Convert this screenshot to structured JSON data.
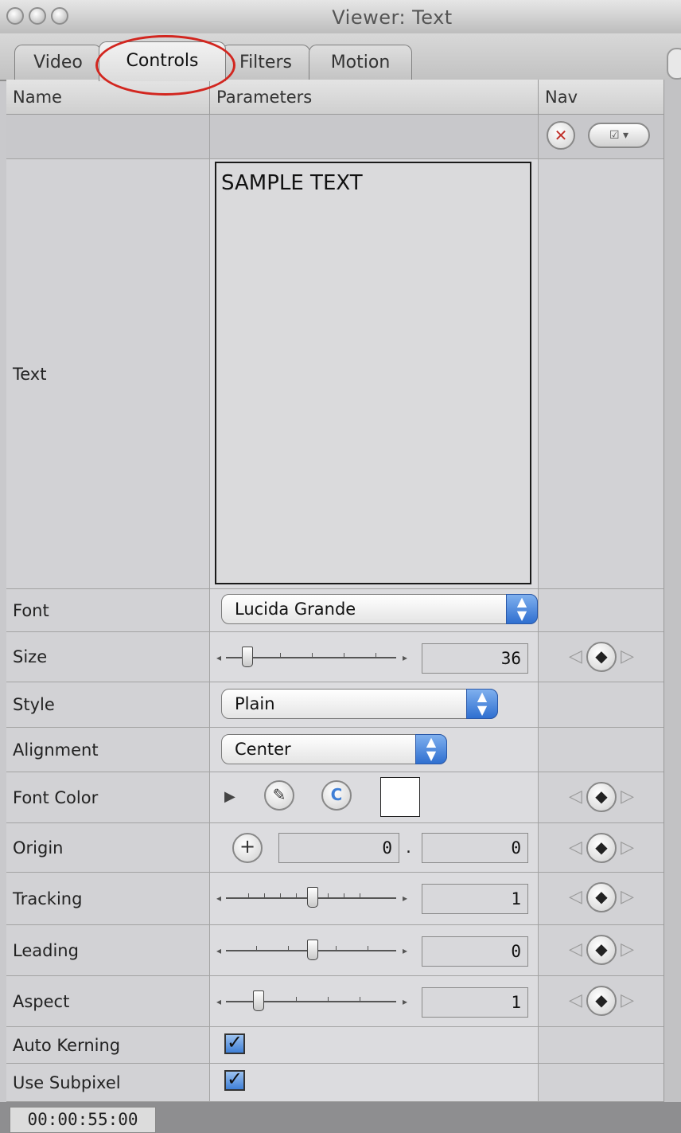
{
  "window": {
    "title": "Viewer: Text"
  },
  "tabs": [
    {
      "label": "Video",
      "active": false
    },
    {
      "label": "Controls",
      "active": true
    },
    {
      "label": "Filters",
      "active": false
    },
    {
      "label": "Motion",
      "active": false
    }
  ],
  "columns": {
    "name": "Name",
    "parameters": "Parameters",
    "nav": "Nav"
  },
  "params": {
    "text": {
      "label": "Text",
      "value": "SAMPLE TEXT"
    },
    "font": {
      "label": "Font",
      "value": "Lucida Grande"
    },
    "size": {
      "label": "Size",
      "value": "36"
    },
    "style": {
      "label": "Style",
      "value": "Plain"
    },
    "alignment": {
      "label": "Alignment",
      "value": "Center"
    },
    "font_color": {
      "label": "Font Color",
      "swatch": "#ffffff"
    },
    "origin": {
      "label": "Origin",
      "x": "0",
      "sep": ".",
      "y": "0"
    },
    "tracking": {
      "label": "Tracking",
      "value": "1"
    },
    "leading": {
      "label": "Leading",
      "value": "0"
    },
    "aspect": {
      "label": "Aspect",
      "value": "1"
    },
    "auto_kerning": {
      "label": "Auto Kerning",
      "checked": true
    },
    "use_subpixel": {
      "label": "Use Subpixel",
      "checked": true
    }
  },
  "status": {
    "timecode": "00:00:55:00"
  },
  "colors": {
    "annotation_circle": "#d2261f",
    "accent_blue": "#3f7fd6"
  }
}
